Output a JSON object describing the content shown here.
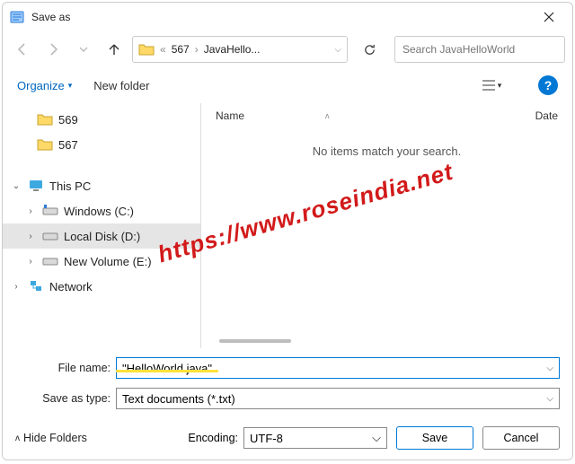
{
  "title": "Save as",
  "breadcrumb": {
    "prefix": "«",
    "parent": "567",
    "current": "JavaHello..."
  },
  "search_placeholder": "Search JavaHelloWorld",
  "toolbar": {
    "organize": "Organize",
    "new_folder": "New folder",
    "help": "?"
  },
  "nav": {
    "folders": [
      {
        "label": "569"
      },
      {
        "label": "567"
      }
    ],
    "this_pc": "This PC",
    "drives": [
      {
        "label": "Windows (C:)"
      },
      {
        "label": "Local Disk (D:)"
      },
      {
        "label": "New Volume (E:)"
      }
    ],
    "network": "Network"
  },
  "content": {
    "col_name": "Name",
    "col_date": "Date",
    "empty": "No items match your search."
  },
  "filename_label": "File name:",
  "filename_value": "\"HelloWorld.java\"",
  "savetype_label": "Save as type:",
  "savetype_value": "Text documents (*.txt)",
  "encoding_label": "Encoding:",
  "encoding_value": "UTF-8",
  "hide_folders": "Hide Folders",
  "save": "Save",
  "cancel": "Cancel",
  "watermark": "https://www.roseindia.net"
}
